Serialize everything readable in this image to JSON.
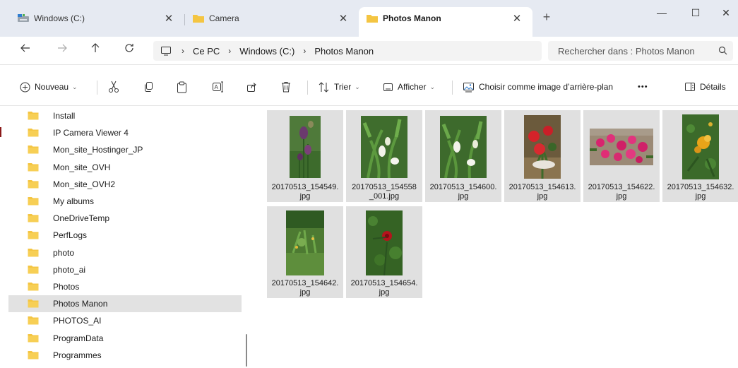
{
  "tabs": [
    {
      "label": "Windows (C:)",
      "icon": "drive-icon"
    },
    {
      "label": "Camera",
      "icon": "folder-icon"
    },
    {
      "label": "Photos Manon",
      "icon": "folder-icon",
      "active": true
    }
  ],
  "new_tab_label": "+",
  "window_controls": {
    "minimize": "—",
    "maximize": "☐",
    "close": "✕"
  },
  "breadcrumb": [
    "Ce PC",
    "Windows (C:)",
    "Photos Manon"
  ],
  "search": {
    "placeholder": "Rechercher dans : Photos Manon"
  },
  "toolbar": {
    "new_label": "Nouveau",
    "sort_label": "Trier",
    "view_label": "Afficher",
    "set_background_label": "Choisir comme image d’arrière-plan",
    "more_label": "•••",
    "details_label": "Détails"
  },
  "nav_items": [
    {
      "label": "Install"
    },
    {
      "label": "IP Camera Viewer 4"
    },
    {
      "label": "Mon_site_Hostinger_JP"
    },
    {
      "label": "Mon_site_OVH"
    },
    {
      "label": "Mon_site_OVH2"
    },
    {
      "label": "My albums"
    },
    {
      "label": "OneDriveTemp"
    },
    {
      "label": "PerfLogs"
    },
    {
      "label": "photo"
    },
    {
      "label": "photo_ai"
    },
    {
      "label": "Photos"
    },
    {
      "label": "Photos Manon",
      "selected": true
    },
    {
      "label": "PHOTOS_AI"
    },
    {
      "label": "ProgramData"
    },
    {
      "label": "Programmes"
    }
  ],
  "files": [
    {
      "line1": "20170513_154549.",
      "line2": "jpg",
      "thumb": "iris-photo"
    },
    {
      "line1": "20170513_154558",
      "line2": "_001.jpg",
      "thumb": "calla-lily-photo"
    },
    {
      "line1": "20170513_154600.",
      "line2": "jpg",
      "thumb": "calla-lily-photo-2"
    },
    {
      "line1": "20170513_154613.",
      "line2": "jpg",
      "thumb": "red-geranium-photo"
    },
    {
      "line1": "20170513_154622.",
      "line2": "jpg",
      "thumb": "pink-flowers-photo"
    },
    {
      "line1": "20170513_154632.",
      "line2": "jpg",
      "thumb": "yellow-rose-photo"
    },
    {
      "line1": "20170513_154642.",
      "line2": "jpg",
      "thumb": "garden-photo"
    },
    {
      "line1": "20170513_154654.",
      "line2": "jpg",
      "thumb": "red-rose-photo"
    }
  ],
  "colors": {
    "folder": "#f4c542",
    "selected": "#e2e2e2",
    "tile": "#e0e0e0",
    "tabbar": "#e6eaf2"
  }
}
